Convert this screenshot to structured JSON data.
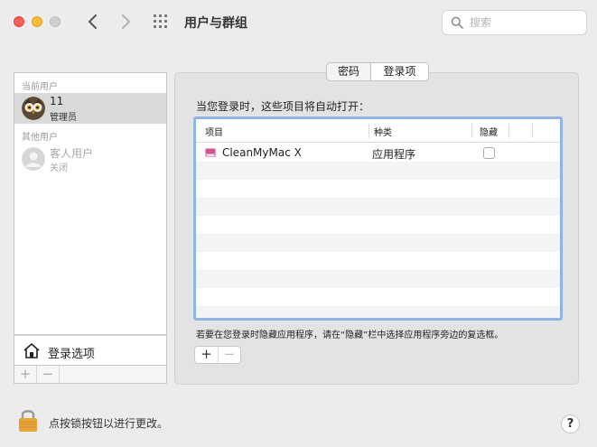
{
  "window": {
    "title": "用户与群组"
  },
  "toolbar": {
    "search_placeholder": "搜索"
  },
  "sidebar": {
    "current_users_label": "当前用户",
    "current_user": {
      "name": "11",
      "role": "管理员"
    },
    "other_users_label": "其他用户",
    "guest_user": {
      "name": "客人用户",
      "status": "关闭"
    },
    "login_options_label": "登录选项",
    "add_label": "+",
    "remove_label": "−"
  },
  "tabs": [
    {
      "label": "密码",
      "selected": false
    },
    {
      "label": "登录项",
      "selected": true
    }
  ],
  "login_items": {
    "intro": "当您登录时，这些项目将自动打开：",
    "columns": {
      "item": "项目",
      "kind": "种类",
      "hide": "隐藏"
    },
    "rows": [
      {
        "name": "CleanMyMac X",
        "kind": "应用程序",
        "hidden": false
      }
    ],
    "hint": "若要在您登录时隐藏应用程序，请在“隐藏”栏中选择应用程序旁边的复选框。",
    "add_label": "+",
    "remove_label": "−"
  },
  "footer": {
    "lock_text": "点按锁按钮以进行更改。",
    "help_label": "?"
  },
  "colors": {
    "close": "#fe5f57",
    "minimize": "#febc2e",
    "focus_ring": "#8fb4e8",
    "selection": "#d9d9d9"
  }
}
